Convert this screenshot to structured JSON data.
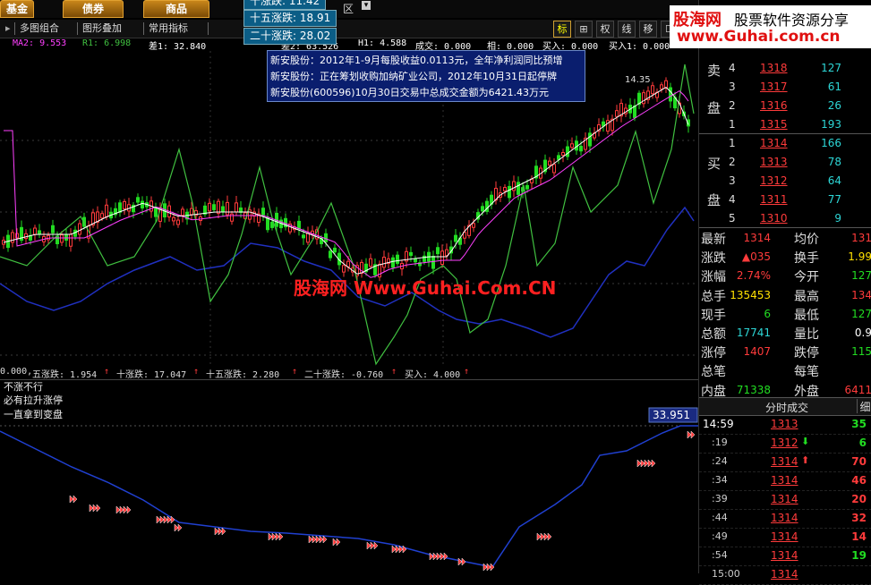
{
  "tabs": [
    {
      "label": "基金"
    },
    {
      "label": "债券"
    },
    {
      "label": "商品"
    }
  ],
  "tab_hidden_suffix": "区",
  "toolbar": {
    "multi_chart": "多图组合",
    "overlay": "图形叠加",
    "common_indicators": "常用指标",
    "icons": [
      {
        "label": "标",
        "icon": "mark-icon"
      },
      {
        "label": "⊞",
        "icon": "crosshair-icon"
      },
      {
        "label": "权",
        "icon": "rights-icon"
      },
      {
        "label": "线",
        "icon": "line-icon"
      },
      {
        "label": "移",
        "icon": "move-icon"
      },
      {
        "label": "☐",
        "icon": "window-icon"
      }
    ]
  },
  "indicator_row": {
    "ma2": "MA2: 9.553",
    "r1": "R1: 6.998",
    "diff1": "差1: 32.840",
    "diff2": "差2: 63.526",
    "h1": "H1: 4.588",
    "deal": "成交: 0.000",
    "phase": "相: 0.000",
    "buy_in": "买入: 0.000",
    "buy_in1": "买入1: 0.000"
  },
  "popups": [
    {
      "label": "十涨跌: 11.42"
    },
    {
      "label": "十五涨跌: 18.91"
    },
    {
      "label": "二十涨跌: 28.02"
    }
  ],
  "news_tips": [
    "新安股份：2012年1-9月每股收益0.0113元，全年净利润同比预增",
    "新安股份：正在筹划收购加纳矿业公司，2012年10月31日起停牌",
    "新安股份(600596)10月30日交易中总成交金额为6421.43万元"
  ],
  "chart_annotation": "14.35",
  "watermark_center": "股海网 Www.Guhai.Com.CN",
  "watermark_corner": {
    "title": "股海网",
    "slogan": "股票软件资源分享",
    "url": "www.Guhai.com.cn"
  },
  "sub_indicator_row": [
    {
      "text": "0.000,"
    },
    {
      "text": "五涨跌: 1.954"
    },
    {
      "text": "十涨跌: 17.047"
    },
    {
      "text": "十五涨跌: 2.280"
    },
    {
      "text": "二十涨跌: -0.760"
    },
    {
      "text": "买入: 4.000"
    }
  ],
  "sub_labels": [
    "不涨不行",
    "必有拉升涨停",
    "一直拿到变盘"
  ],
  "sub_value_box": "33.951",
  "order_book": {
    "sell_label_1": "卖",
    "sell_label_2": "盘",
    "buy_label_1": "买",
    "buy_label_2": "盘",
    "sell": [
      {
        "level": "4",
        "price": "1318",
        "vol": "127"
      },
      {
        "level": "3",
        "price": "1317",
        "vol": "61"
      },
      {
        "level": "2",
        "price": "1316",
        "vol": "26"
      },
      {
        "level": "1",
        "price": "1315",
        "vol": "193"
      }
    ],
    "buy": [
      {
        "level": "1",
        "price": "1314",
        "vol": "166"
      },
      {
        "level": "2",
        "price": "1313",
        "vol": "78"
      },
      {
        "level": "3",
        "price": "1312",
        "vol": "64"
      },
      {
        "level": "4",
        "price": "1311",
        "vol": "77"
      },
      {
        "level": "5",
        "price": "1310",
        "vol": "9"
      }
    ]
  },
  "stats": [
    {
      "l1": "最新",
      "v1": "1314",
      "c1": "red",
      "l2": "均价",
      "v2": "131",
      "c2": "red"
    },
    {
      "l1": "涨跌",
      "v1": "▲035",
      "c1": "red",
      "l2": "换手",
      "v2": "1.99",
      "c2": "yel"
    },
    {
      "l1": "涨幅",
      "v1": "2.74%",
      "c1": "red",
      "l2": "今开",
      "v2": "127",
      "c2": "grn"
    },
    {
      "l1": "总手",
      "v1": "135453",
      "c1": "yel",
      "l2": "最高",
      "v2": "134",
      "c2": "red"
    },
    {
      "l1": "现手",
      "v1": "6",
      "c1": "grn",
      "l2": "最低",
      "v2": "127",
      "c2": "grn"
    },
    {
      "l1": "总额",
      "v1": "17741",
      "c1": "cyn",
      "l2": "量比",
      "v2": "0.9",
      "c2": "wht"
    },
    {
      "l1": "涨停",
      "v1": "1407",
      "c1": "red",
      "l2": "跌停",
      "v2": "115",
      "c2": "grn"
    },
    {
      "l1": "总笔",
      "v1": "",
      "c1": "wht",
      "l2": "每笔",
      "v2": "",
      "c2": "wht"
    },
    {
      "l1": "内盘",
      "v1": "71338",
      "c1": "grn",
      "l2": "外盘",
      "v2": "6411",
      "c2": "red"
    }
  ],
  "ticks_header": {
    "title": "分时成交",
    "detail": "细"
  },
  "ticks": [
    {
      "time": "14:59",
      "price": "1313",
      "arrow": "",
      "vol": "35",
      "vc": "grn"
    },
    {
      "time": ":19",
      "price": "1312",
      "arrow": "⬇",
      "vol": "6",
      "vc": "grn"
    },
    {
      "time": ":24",
      "price": "1314",
      "arrow": "⬆",
      "vol": "70",
      "vc": "red"
    },
    {
      "time": ":34",
      "price": "1314",
      "arrow": "",
      "vol": "46",
      "vc": "red"
    },
    {
      "time": ":39",
      "price": "1314",
      "arrow": "",
      "vol": "20",
      "vc": "red"
    },
    {
      "time": ":44",
      "price": "1314",
      "arrow": "",
      "vol": "32",
      "vc": "red"
    },
    {
      "time": ":49",
      "price": "1314",
      "arrow": "",
      "vol": "14",
      "vc": "red"
    },
    {
      "time": ":54",
      "price": "1314",
      "arrow": "",
      "vol": "19",
      "vc": "grn"
    },
    {
      "time": "15:00",
      "price": "1314",
      "arrow": "",
      "vol": "",
      "vc": "grn"
    }
  ],
  "colors": {
    "up": "#ff3b3b",
    "down": "#22dd22",
    "ma1": "#ffffff",
    "ma2": "#ff40ff",
    "osc": "#40c040",
    "blue": "#2030c0"
  }
}
